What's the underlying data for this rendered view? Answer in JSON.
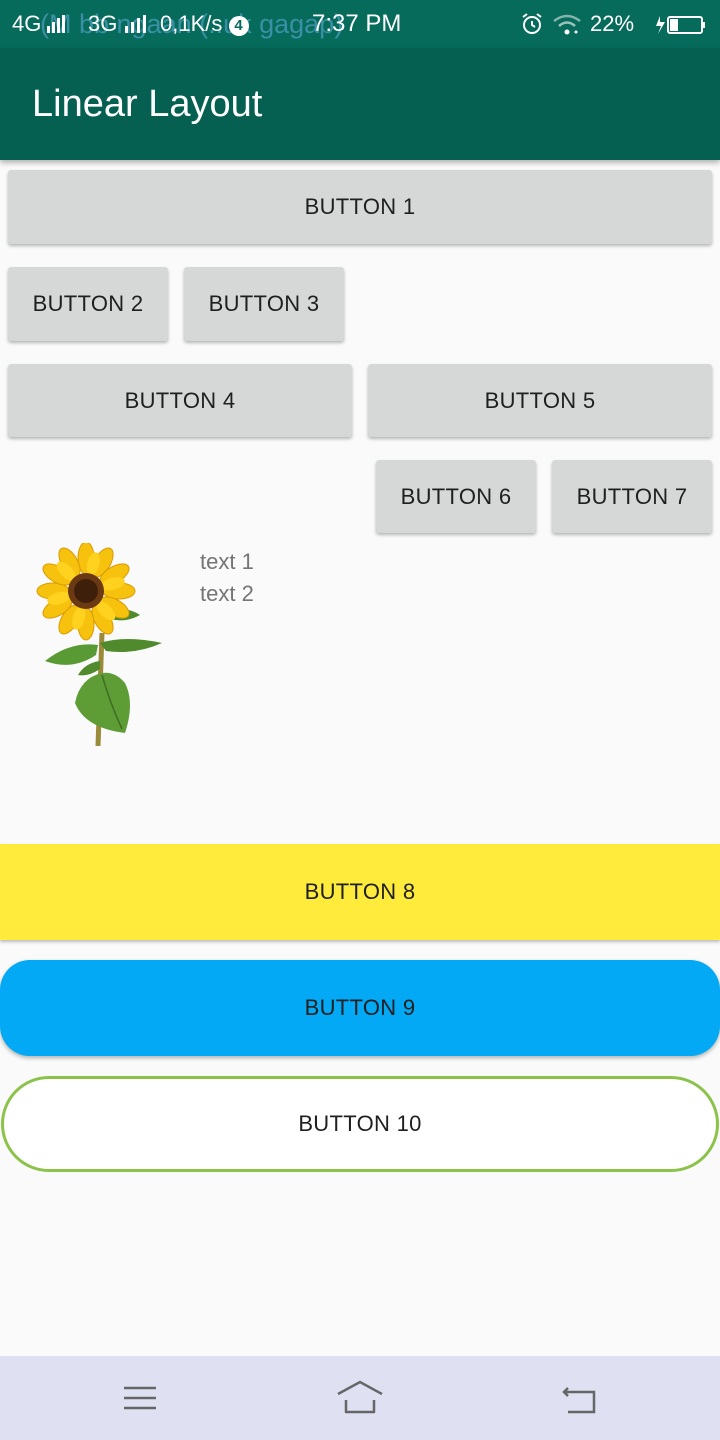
{
  "status_bar": {
    "network_1": "4G",
    "network_2": "3G",
    "speed": "0,1K/s",
    "notification_count": "4",
    "time": "7:37 PM",
    "battery": "22%",
    "ghost_overlay_text": "(M bb   ngaan (..uk gagap)"
  },
  "app_bar": {
    "title": "Linear Layout"
  },
  "buttons": {
    "b1": "BUTTON 1",
    "b2": "BUTTON 2",
    "b3": "BUTTON 3",
    "b4": "BUTTON 4",
    "b5": "BUTTON 5",
    "b6": "BUTTON 6",
    "b7": "BUTTON 7",
    "b8": "BUTTON 8",
    "b9": "BUTTON 9",
    "b10": "BUTTON 10"
  },
  "texts": {
    "t1": "text 1",
    "t2": "text 2"
  },
  "image": {
    "icon": "sunflower-image"
  },
  "colors": {
    "status_bar": "#066b5b",
    "app_bar": "#066052",
    "button_default": "#d6d7d7",
    "button_8": "#ffeb3b",
    "button_9": "#03a9f4",
    "button_10_border": "#8bc34a",
    "nav_bar": "#dfe1f3"
  },
  "nav_bar": {
    "icons": [
      "menu-icon",
      "home-icon",
      "back-icon"
    ]
  }
}
